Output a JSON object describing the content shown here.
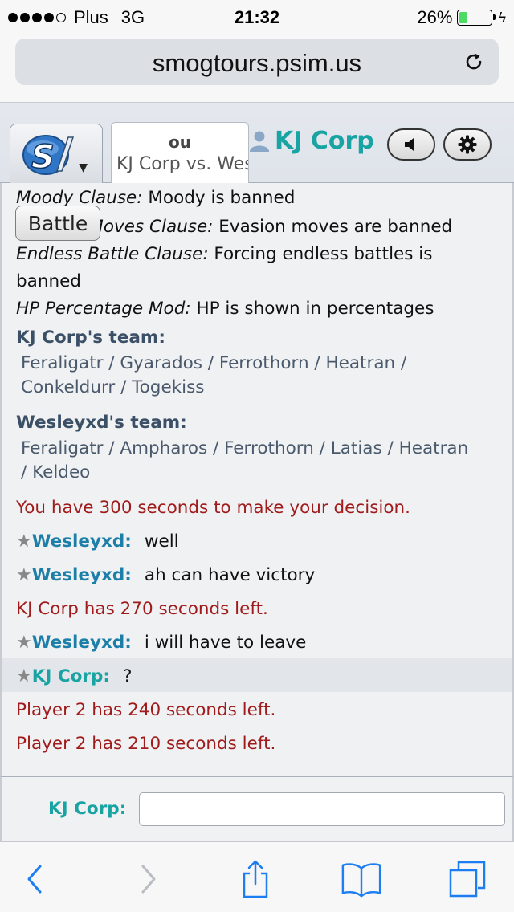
{
  "status_bar": {
    "carrier": "Plus",
    "network": "3G",
    "time": "21:32",
    "battery": "26%",
    "battery_level": 0.26,
    "signal_bars": 4
  },
  "browser": {
    "url": "smogtours.psim.us"
  },
  "app_header": {
    "tab_format": "ou",
    "tab_title": "KJ Corp vs. Wesleyxd",
    "username": "KJ Corp"
  },
  "battle": {
    "button_label": "Battle",
    "rules": [
      {
        "name": "Moody Clause:",
        "text": "Moody is banned"
      },
      {
        "name": "Evasion Moves Clause:",
        "text": "Evasion moves are banned"
      },
      {
        "name": "Endless Battle Clause:",
        "text": "Forcing endless battles is",
        "text2": "banned"
      },
      {
        "name": "HP Percentage Mod:",
        "text": "HP is shown in percentages"
      }
    ],
    "teams": [
      {
        "heading": "KJ Corp's team:",
        "line1": "Feraligatr / Gyarados / Ferrothorn / Heatran /",
        "line2": "Conkeldurr / Togekiss"
      },
      {
        "heading": "Wesleyxd's team:",
        "line1": "Feraligatr / Ampharos / Ferrothorn / Latias / Heatran",
        "line2": "/ Keldeo"
      }
    ],
    "messages": [
      {
        "type": "system",
        "text": "You have 300 seconds to make your decision."
      },
      {
        "type": "chat",
        "user": "Wesleyxd:",
        "text": "well"
      },
      {
        "type": "chat",
        "user": "Wesleyxd:",
        "text": "ah can have victory"
      },
      {
        "type": "system",
        "text": "KJ Corp has 270 seconds left."
      },
      {
        "type": "chat",
        "user": "Wesleyxd:",
        "text": "i will have to leave"
      },
      {
        "type": "chat",
        "user": "KJ Corp:",
        "text": "?"
      },
      {
        "type": "system",
        "text": "Player 2 has 240 seconds left."
      },
      {
        "type": "system",
        "text": "Player 2 has 210 seconds left."
      }
    ],
    "star": "★"
  },
  "chat_input": {
    "label": "KJ Corp:",
    "value": ""
  },
  "colors": {
    "accent_teal": "#1aa3a3",
    "user_blue": "#1d7fa8",
    "system_red": "#a01c1c",
    "ios_blue": "#1c7ef0"
  },
  "toolbar_icons": [
    "back-icon",
    "forward-icon",
    "share-icon",
    "bookmarks-icon",
    "tabs-icon"
  ]
}
